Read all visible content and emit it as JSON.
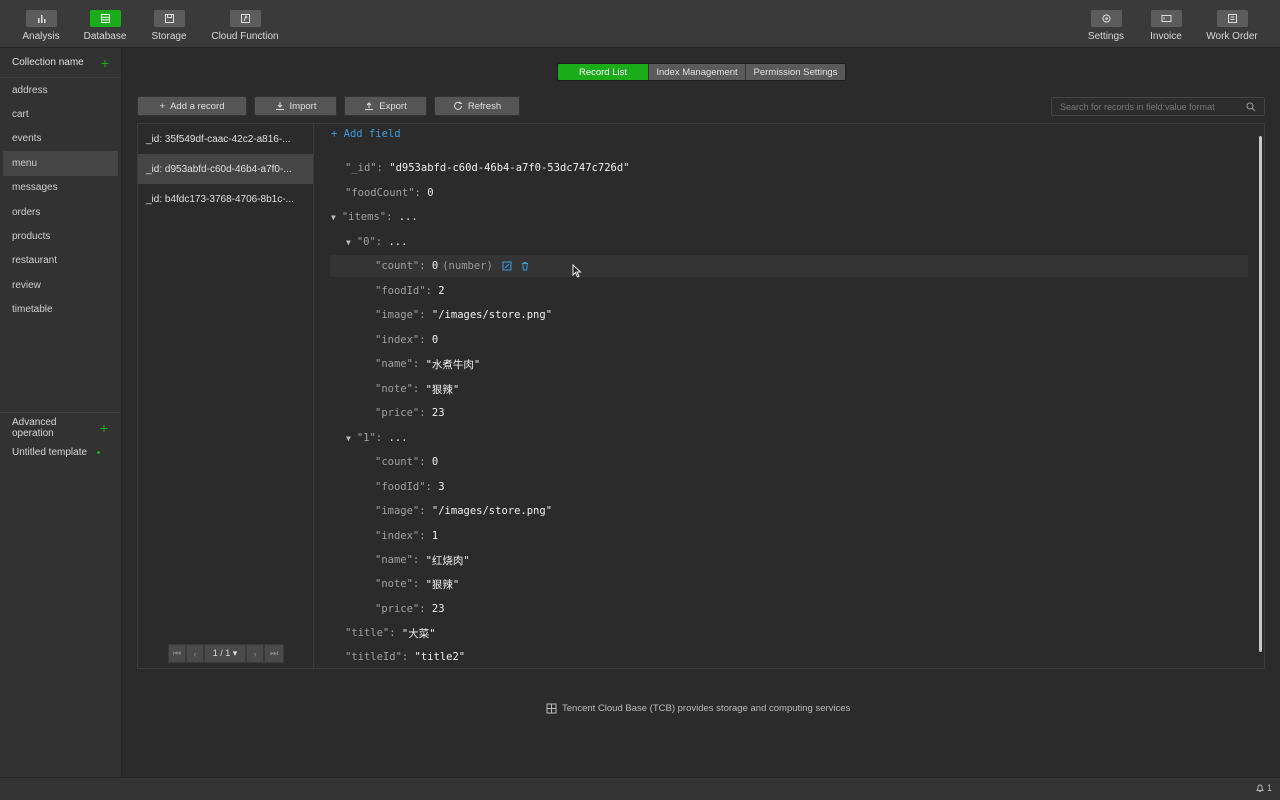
{
  "toolbar": {
    "left": [
      {
        "label": "Analysis",
        "icon": "bar-chart-icon"
      },
      {
        "label": "Database",
        "icon": "database-icon",
        "active": true
      },
      {
        "label": "Storage",
        "icon": "storage-icon"
      },
      {
        "label": "Cloud Function",
        "icon": "cloud-function-icon"
      }
    ],
    "right": [
      {
        "label": "Settings",
        "icon": "gear-icon"
      },
      {
        "label": "Invoice",
        "icon": "invoice-icon"
      },
      {
        "label": "Work Order",
        "icon": "work-order-icon"
      }
    ]
  },
  "sidebar": {
    "header": "Collection name",
    "collections": [
      "address",
      "cart",
      "events",
      "menu",
      "messages",
      "orders",
      "products",
      "restaurant",
      "review",
      "timetable"
    ],
    "selected": "menu",
    "advanced_label": "Advanced operation",
    "template_label": "Untitled template"
  },
  "tabs": [
    "Record List",
    "Index Management",
    "Permission Settings"
  ],
  "actions": {
    "add_record": "Add a record",
    "import": "Import",
    "export": "Export",
    "refresh": "Refresh"
  },
  "search": {
    "placeholder": "Search for records in field:value format"
  },
  "records": [
    "_id: 35f549df-caac-42c2-a816-...",
    "_id: d953abfd-c60d-46b4-a7f0-...",
    "_id: b4fdc173-3768-4706-8b1c-..."
  ],
  "pager": {
    "page": "1 / 1 ▾"
  },
  "document": {
    "add_field": "Add field",
    "id_key": "\"_id\":",
    "id_val": "\"d953abfd-c60d-46b4-a7f0-53dc747c726d\"",
    "foodCount_key": "\"foodCount\":",
    "foodCount_val": "0",
    "items_key": "\"items\":",
    "ellipsis": "...",
    "item0_key": "\"0\":",
    "item0": {
      "count_key": "\"count\":",
      "count_val": "0",
      "count_type": "(number)",
      "foodId_key": "\"foodId\":",
      "foodId_val": "2",
      "image_key": "\"image\":",
      "image_val": "\"/images/store.png\"",
      "index_key": "\"index\":",
      "index_val": "0",
      "name_key": "\"name\":",
      "name_val": "\"水煮牛肉\"",
      "note_key": "\"note\":",
      "note_val": "\"狠辣\"",
      "price_key": "\"price\":",
      "price_val": "23"
    },
    "item1_key": "\"1\":",
    "item1": {
      "count_key": "\"count\":",
      "count_val": "0",
      "foodId_key": "\"foodId\":",
      "foodId_val": "3",
      "image_key": "\"image\":",
      "image_val": "\"/images/store.png\"",
      "index_key": "\"index\":",
      "index_val": "1",
      "name_key": "\"name\":",
      "name_val": "\"红烧肉\"",
      "note_key": "\"note\":",
      "note_val": "\"狠辣\"",
      "price_key": "\"price\":",
      "price_val": "23"
    },
    "title_key": "\"title\":",
    "title_val": "\"大菜\"",
    "titleId_key": "\"titleId\":",
    "titleId_val": "\"title2\""
  },
  "footer": {
    "note": "Tencent Cloud Base (TCB) provides storage and computing services"
  },
  "status": {
    "notifications": "1"
  },
  "colors": {
    "accent": "#1aad19",
    "link": "#3a9be0"
  }
}
